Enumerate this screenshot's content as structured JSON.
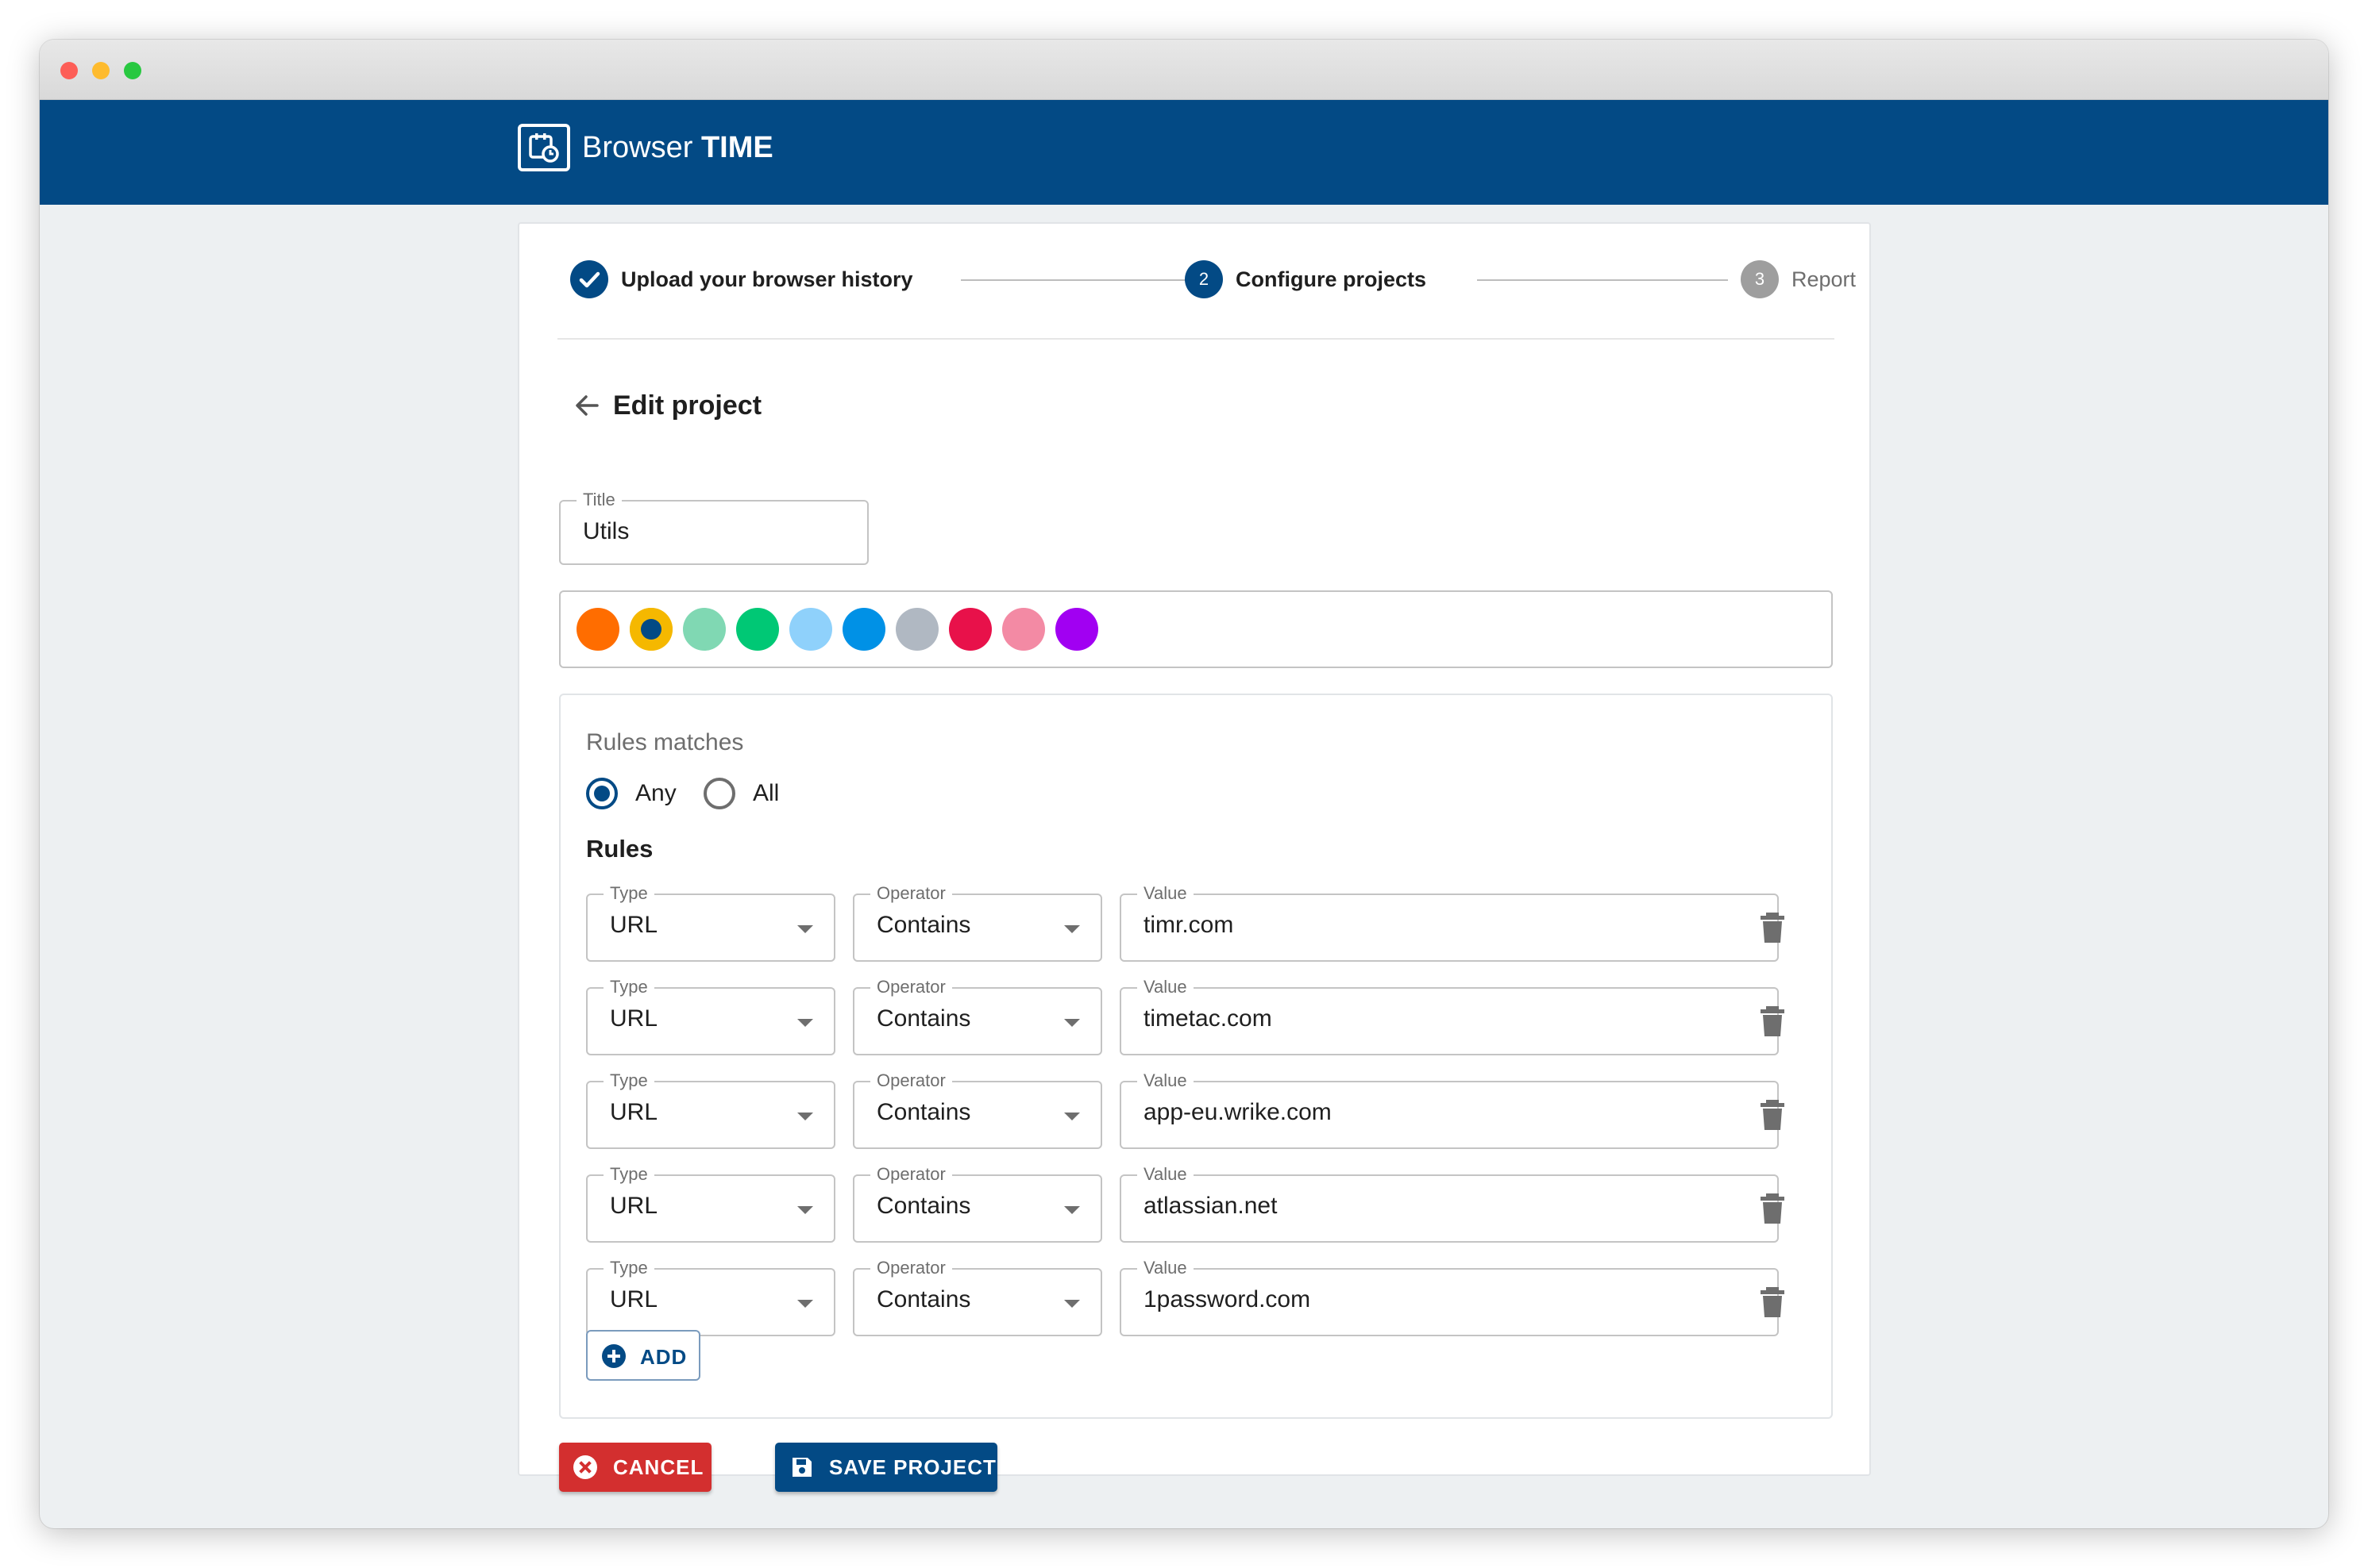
{
  "colors": {
    "brand": "#034a85",
    "danger": "#d32f2f",
    "step_done": "#034a85",
    "step_inactive": "#9e9e9e"
  },
  "app": {
    "name_regular": "Browser",
    "name_bold": "TIME",
    "logo_icon": "calendar-clock-icon"
  },
  "stepper": {
    "steps": [
      {
        "number": "",
        "label": "Upload your browser history",
        "state": "completed",
        "icon": "check-icon"
      },
      {
        "number": "2",
        "label": "Configure projects",
        "state": "active"
      },
      {
        "number": "3",
        "label": "Report",
        "state": "inactive"
      }
    ]
  },
  "form": {
    "heading": "Edit project",
    "back_icon": "arrow-left-icon",
    "title_label": "Title",
    "title_value": "Utils",
    "colors": [
      "#ff6d00",
      "#034a85",
      "#80d8b3",
      "#00c875",
      "#8fd1fb",
      "#0091e6",
      "#b0b8c2",
      "#e8114a",
      "#f38aa4",
      "#a100f2"
    ],
    "selected_color_index": 1
  },
  "rules": {
    "matches_label": "Rules matches",
    "options": [
      {
        "label": "Any",
        "checked": true
      },
      {
        "label": "All",
        "checked": false
      }
    ],
    "heading": "Rules",
    "type_label": "Type",
    "operator_label": "Operator",
    "value_label": "Value",
    "rows": [
      {
        "type": "URL",
        "operator": "Contains",
        "value": "timr.com"
      },
      {
        "type": "URL",
        "operator": "Contains",
        "value": "timetac.com"
      },
      {
        "type": "URL",
        "operator": "Contains",
        "value": "app-eu.wrike.com"
      },
      {
        "type": "URL",
        "operator": "Contains",
        "value": "atlassian.net"
      },
      {
        "type": "URL",
        "operator": "Contains",
        "value": "1password.com"
      }
    ],
    "delete_icon": "trash-icon",
    "add_label": "ADD"
  },
  "actions": {
    "cancel_label": "CANCEL",
    "save_label": "SAVE PROJECT"
  }
}
